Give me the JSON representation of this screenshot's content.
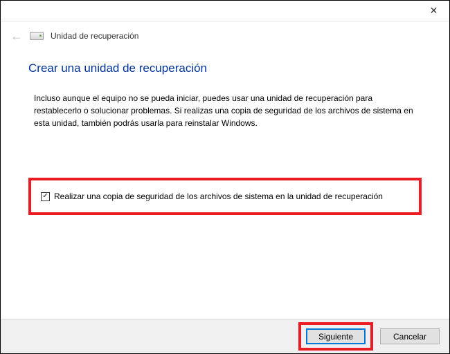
{
  "titlebar": {
    "close_glyph": "✕"
  },
  "header": {
    "back_arrow": "←",
    "window_title": "Unidad de recuperación"
  },
  "content": {
    "heading": "Crear una unidad de recuperación",
    "description": "Incluso aunque el equipo no se pueda iniciar, puedes usar una unidad de recuperación para restablecerlo o solucionar problemas. Si realizas una copia de seguridad de los archivos de sistema en esta unidad, también podrás usarla para reinstalar Windows."
  },
  "checkbox": {
    "checked_glyph": "✓",
    "label": "Realizar una copia de seguridad de los archivos de sistema en la unidad de recuperación"
  },
  "footer": {
    "next_label": "Siguiente",
    "cancel_label": "Cancelar"
  }
}
